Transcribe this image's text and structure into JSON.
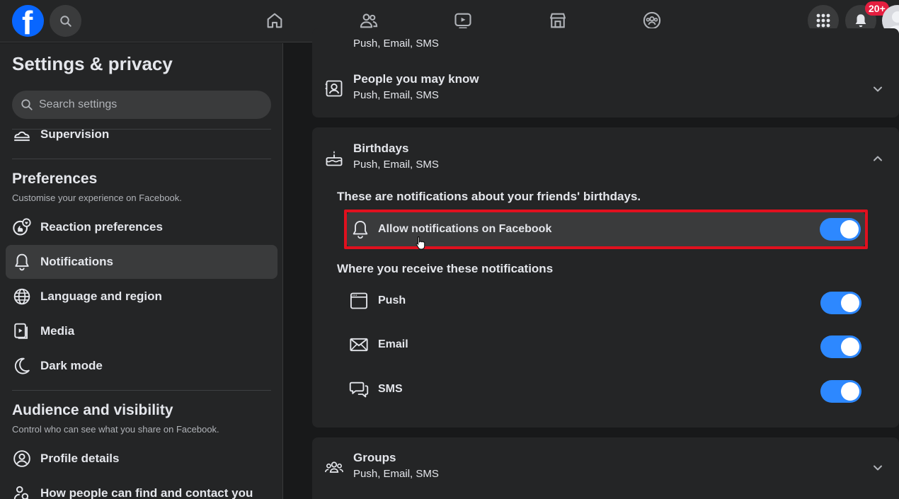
{
  "topbar": {
    "logo_letter": "f",
    "notification_badge": "20+",
    "nav_icons": [
      "home-icon",
      "friends-icon",
      "watch-icon",
      "marketplace-icon",
      "groups-icon"
    ]
  },
  "sidebar": {
    "title": "Settings & privacy",
    "search_placeholder": "Search settings",
    "top_items": [
      {
        "label": "Supervision",
        "icon": "supervision-icon"
      }
    ],
    "preferences": {
      "title": "Preferences",
      "subtitle": "Customise your experience on Facebook.",
      "items": [
        {
          "label": "Reaction preferences",
          "icon": "reaction-icon"
        },
        {
          "label": "Notifications",
          "icon": "bell-icon",
          "active": true
        },
        {
          "label": "Language and region",
          "icon": "globe-icon"
        },
        {
          "label": "Media",
          "icon": "media-icon"
        },
        {
          "label": "Dark mode",
          "icon": "moon-icon"
        }
      ]
    },
    "audience": {
      "title": "Audience and visibility",
      "subtitle": "Control who can see what you share on Facebook.",
      "items": [
        {
          "label": "Profile details",
          "icon": "profile-icon"
        },
        {
          "label": "How people can find and contact you",
          "icon": "find-contact-icon"
        }
      ]
    }
  },
  "main": {
    "prev_card_sub": "Push, Email, SMS",
    "people_you_may_know": {
      "title": "People you may know",
      "sub": "Push, Email, SMS"
    },
    "birthdays": {
      "title": "Birthdays",
      "sub": "Push, Email, SMS",
      "description": "These are notifications about your friends' birthdays.",
      "allow_label": "Allow notifications on Facebook",
      "allow_on": true,
      "where_label": "Where you receive these notifications",
      "channels": [
        {
          "label": "Push",
          "on": true,
          "icon": "push-icon"
        },
        {
          "label": "Email",
          "on": true,
          "icon": "email-icon"
        },
        {
          "label": "SMS",
          "on": true,
          "icon": "sms-icon"
        }
      ]
    },
    "groups": {
      "title": "Groups",
      "sub": "Push, Email, SMS"
    }
  },
  "colors": {
    "accent": "#2d88ff",
    "highlight": "#e0101e",
    "brand": "#0866ff",
    "badge": "#e41e3f"
  }
}
